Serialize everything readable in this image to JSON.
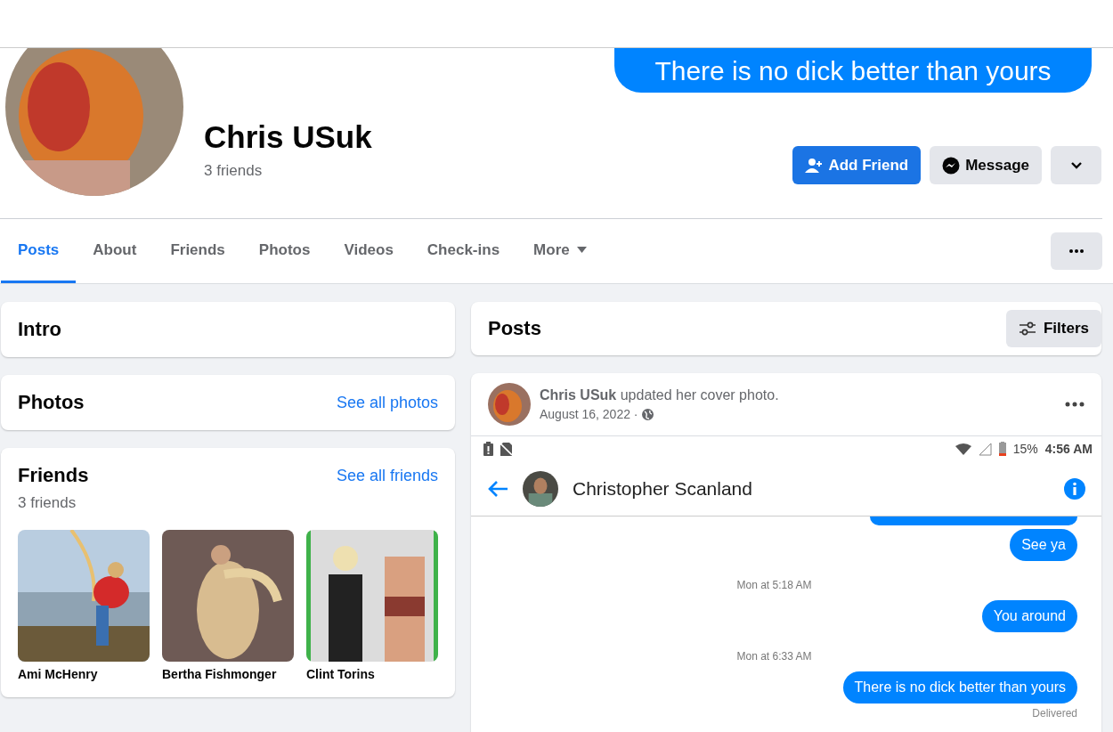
{
  "cover": {
    "message": "There is no dick better than yours"
  },
  "profile": {
    "name": "Chris USuk",
    "friends_count": "3 friends"
  },
  "actions": [
    {
      "kind": "primary",
      "label": "Add Friend"
    },
    {
      "kind": "secondary",
      "label": "Message"
    },
    {
      "kind": "dropdown"
    }
  ],
  "tabs": [
    {
      "label": "Posts",
      "selected": true,
      "kind": "link"
    },
    {
      "label": "About",
      "selected": false,
      "kind": "link"
    },
    {
      "label": "Friends",
      "selected": false,
      "kind": "link"
    },
    {
      "label": "Photos",
      "selected": false,
      "kind": "link"
    },
    {
      "label": "Videos",
      "selected": false,
      "kind": "link"
    },
    {
      "label": "Check-ins",
      "selected": false,
      "kind": "link"
    },
    {
      "label": "More",
      "selected": false,
      "kind": "menu"
    }
  ],
  "intro": {
    "title": "Intro"
  },
  "photos": {
    "title": "Photos",
    "link": "See all photos"
  },
  "friends": {
    "title": "Friends",
    "link": "See all friends",
    "count": "3 friends",
    "people": [
      {
        "name": "Ami McHenry",
        "kind": "picture"
      },
      {
        "name": "Bertha Fishmonger",
        "kind": "picture"
      },
      {
        "name": "Clint Torins",
        "kind": "picture"
      }
    ]
  },
  "posts": {
    "title": "Posts",
    "filters": "Filters"
  },
  "post": {
    "author": "Chris USuk",
    "action": "updated her cover photo.",
    "date": "August 16, 2022 ·"
  },
  "phone": {
    "battery": "15%",
    "time": "4:56 AM",
    "contact": "Christopher Scanland",
    "receipt": "Delivered",
    "messages": [
      {
        "kind": "cut"
      },
      {
        "kind": "sent",
        "text": "See ya"
      },
      {
        "kind": "time",
        "text": "Mon at 5:18 AM"
      },
      {
        "kind": "sent",
        "text": "You around"
      },
      {
        "kind": "time",
        "text": "Mon at 6:33 AM"
      },
      {
        "kind": "sent",
        "text": "There is no dick better than yours"
      }
    ]
  }
}
